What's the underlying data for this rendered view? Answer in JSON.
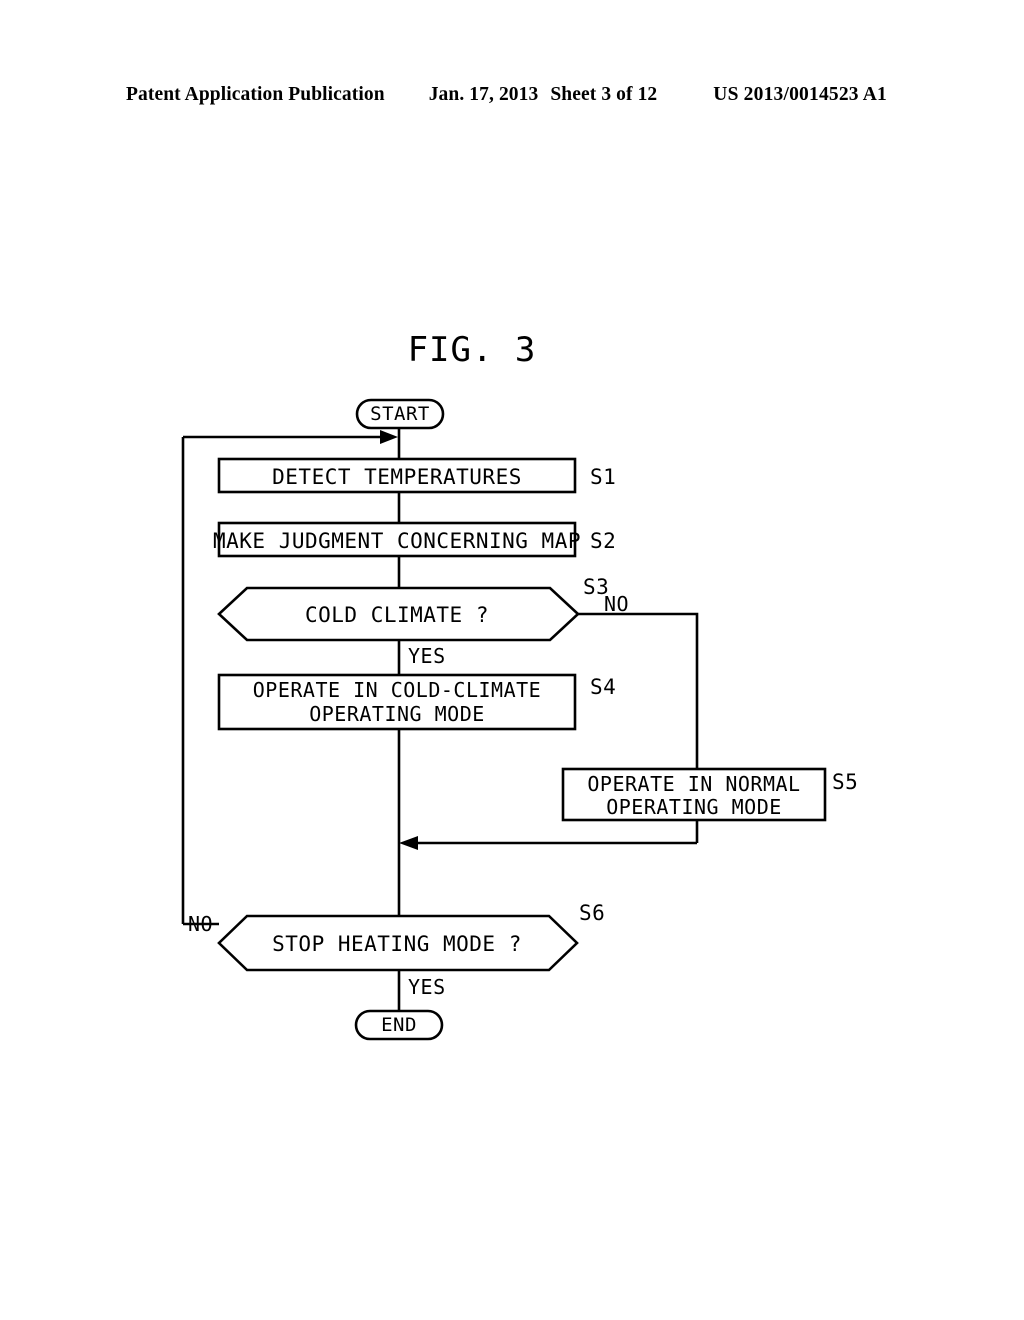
{
  "header": {
    "publication": "Patent Application Publication",
    "date": "Jan. 17, 2013",
    "sheet": "Sheet 3 of 12",
    "document_number": "US 2013/0014523 A1"
  },
  "figure": {
    "title": "FIG. 3"
  },
  "flowchart": {
    "start_label": "START",
    "end_label": "END",
    "nodes": {
      "s1": {
        "step": "S1",
        "text": "DETECT TEMPERATURES"
      },
      "s2": {
        "step": "S2",
        "text": "MAKE JUDGMENT CONCERNING MAP"
      },
      "s3": {
        "step": "S3",
        "text": "COLD CLIMATE ?"
      },
      "s4": {
        "step": "S4",
        "line1": "OPERATE IN COLD-CLIMATE",
        "line2": "OPERATING MODE"
      },
      "s5": {
        "step": "S5",
        "line1": "OPERATE IN NORMAL",
        "line2": "OPERATING MODE"
      },
      "s6": {
        "step": "S6",
        "text": "STOP HEATING MODE ?"
      }
    },
    "branches": {
      "s3_no": "NO",
      "s3_yes": "YES",
      "s6_no": "NO",
      "s6_yes": "YES"
    }
  },
  "colors": {
    "ink": "#000000",
    "paper": "#ffffff"
  }
}
